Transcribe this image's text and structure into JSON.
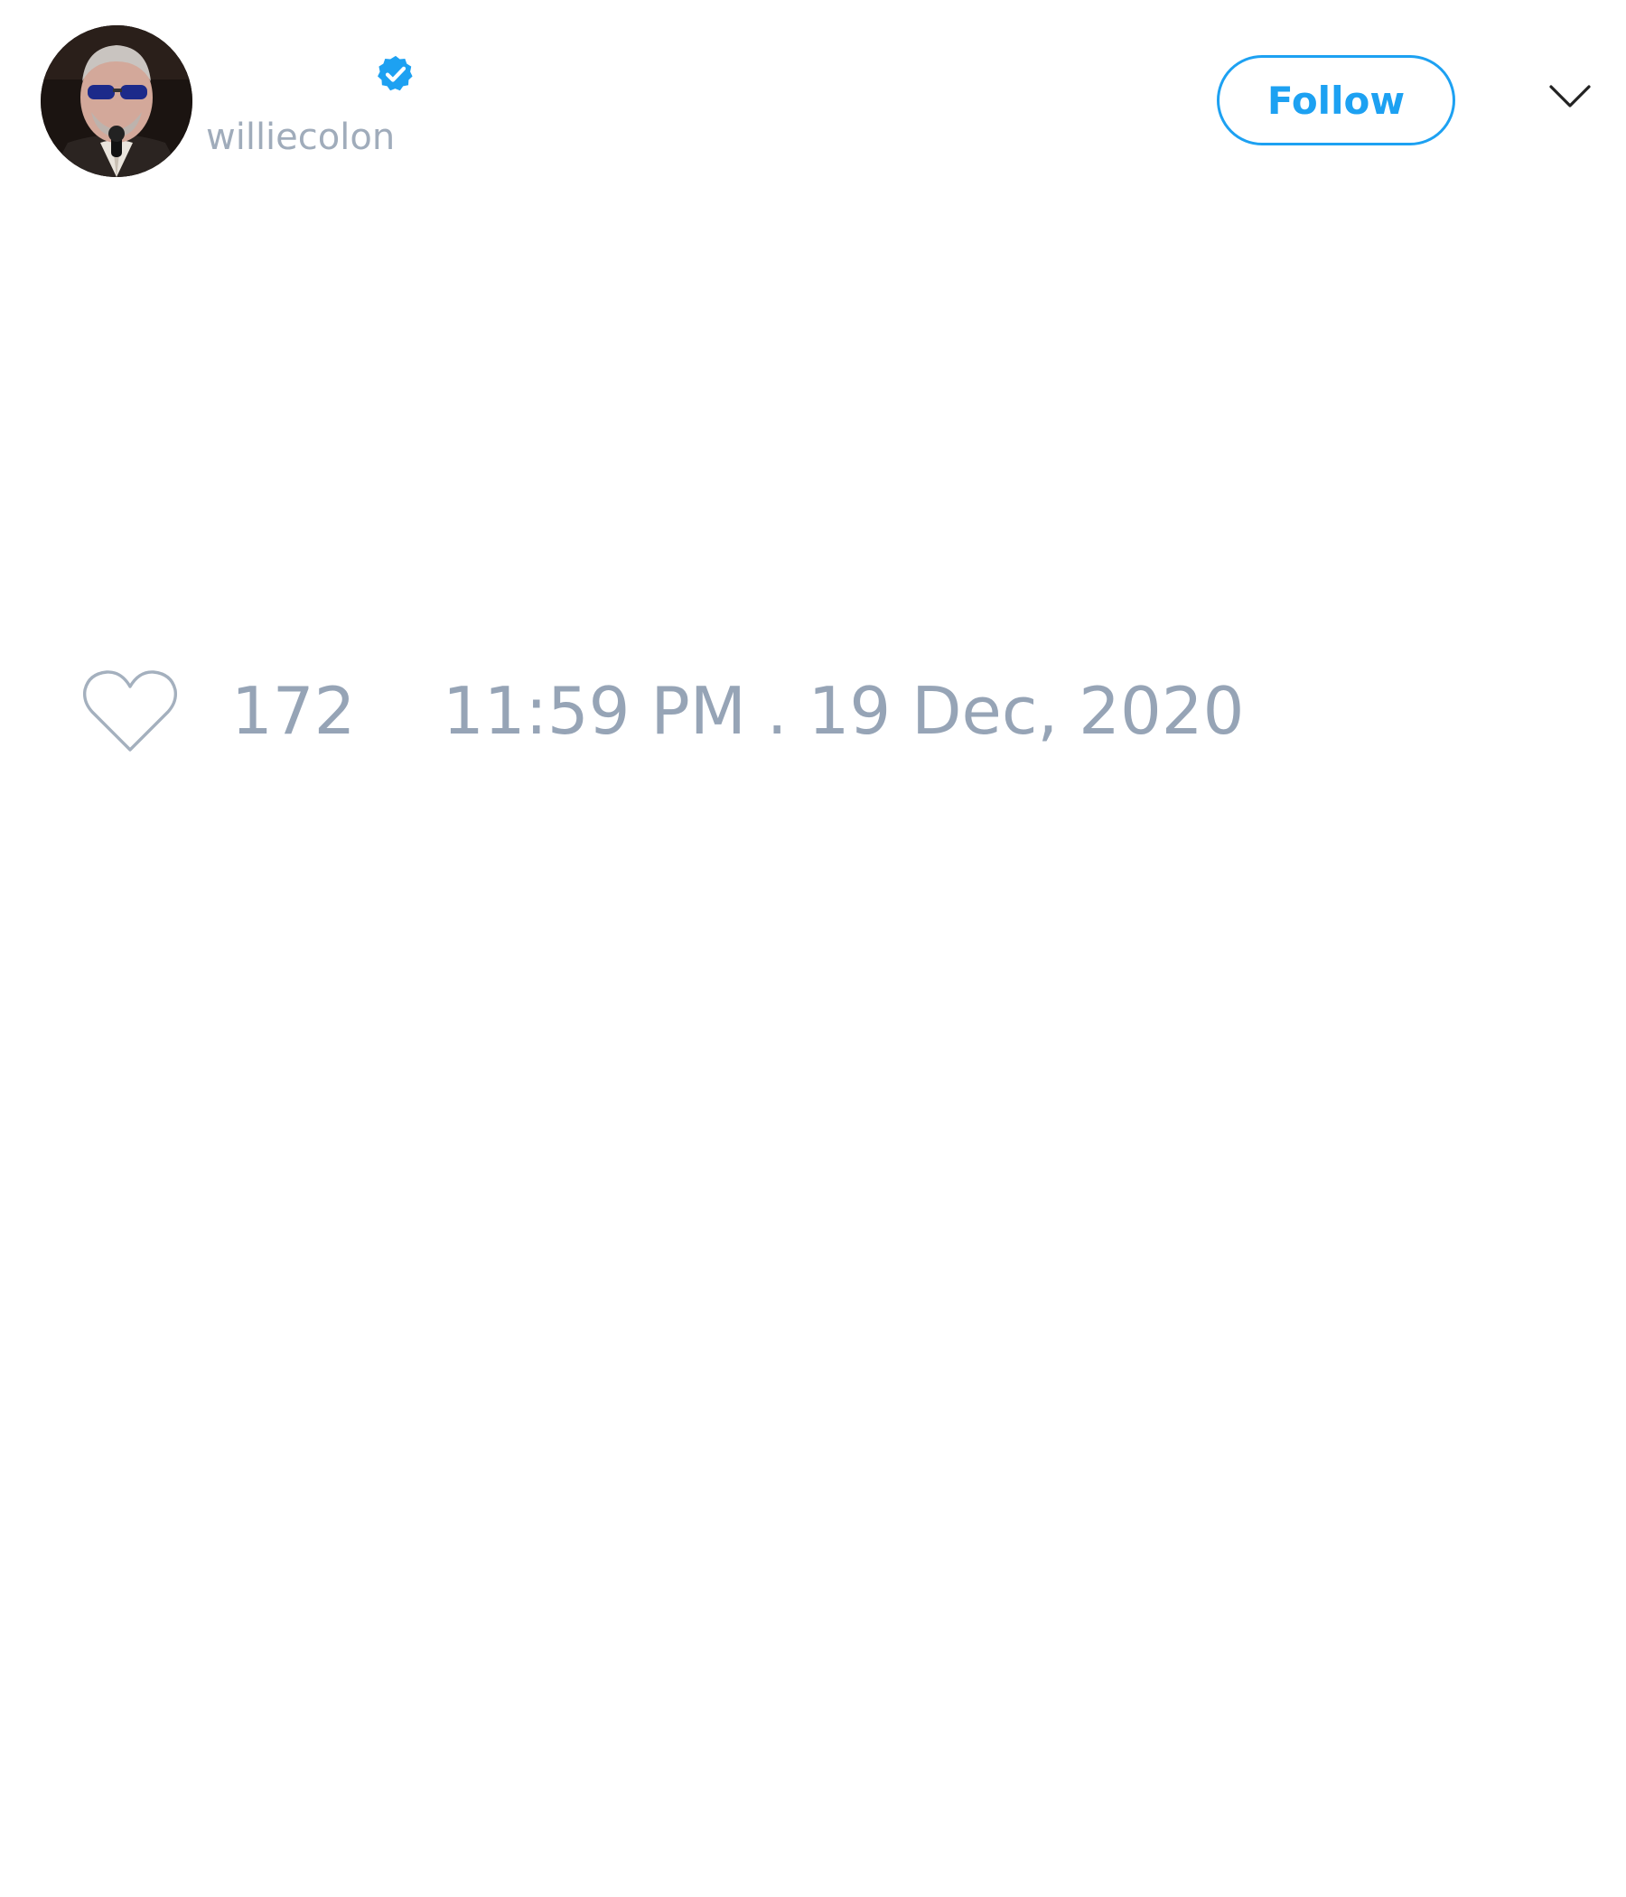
{
  "user": {
    "handle": "williecolon",
    "verified": true
  },
  "header": {
    "follow_label": "Follow"
  },
  "tweet": {
    "like_count": "172",
    "timestamp": "11:59 PM . 19 Dec, 2020"
  },
  "icons": {
    "verified": "verified-badge-icon",
    "menu": "chevron-down-icon",
    "like": "heart-icon"
  },
  "colors": {
    "accent": "#1da1f2",
    "muted_text": "#96a4b6",
    "background": "#ffffff"
  }
}
